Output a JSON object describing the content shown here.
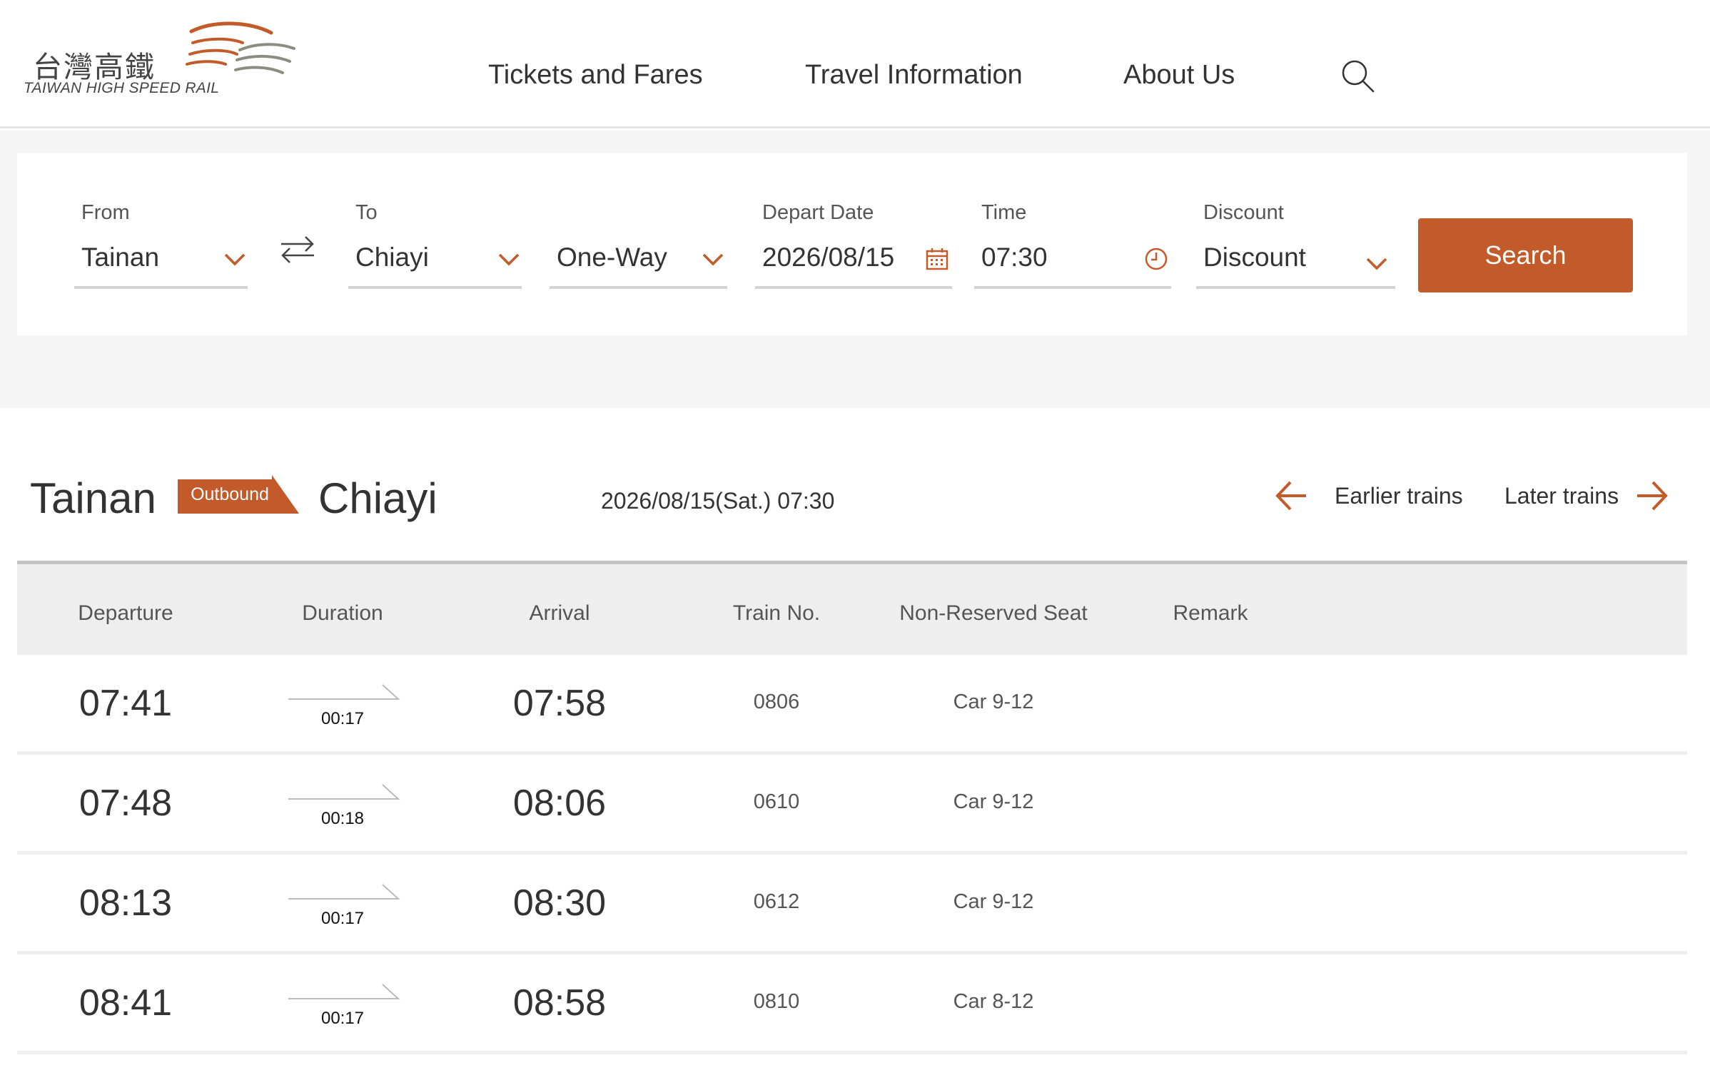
{
  "header": {
    "logo_cn": "台灣高鐵",
    "logo_en": "TAIWAN HIGH SPEED RAIL",
    "nav": [
      {
        "label": "Tickets and Fares"
      },
      {
        "label": "Travel Information"
      },
      {
        "label": "About Us"
      }
    ],
    "search_icon": "search-icon"
  },
  "search_form": {
    "from": {
      "label": "From",
      "value": "Tainan"
    },
    "to": {
      "label": "To",
      "value": "Chiayi"
    },
    "trip_type": {
      "value": "One-Way"
    },
    "depart_date": {
      "label": "Depart Date",
      "value": "2026/08/15"
    },
    "time": {
      "label": "Time",
      "value": "07:30"
    },
    "discount": {
      "label": "Discount",
      "value": "Discount"
    },
    "search_label": "Search",
    "swap_icon": "swap-icon"
  },
  "results": {
    "origin": "Tainan",
    "direction_badge": "Outbound",
    "destination": "Chiayi",
    "datetime": "2026/08/15(Sat.) 07:30",
    "earlier_label": "Earlier trains",
    "later_label": "Later trains",
    "columns": [
      "Departure",
      "Duration",
      "Arrival",
      "Train No.",
      "Non-Reserved Seat",
      "Remark"
    ],
    "rows": [
      {
        "departure": "07:41",
        "duration": "00:17",
        "arrival": "07:58",
        "train_no": "0806",
        "non_reserved": "Car 9-12",
        "remark": ""
      },
      {
        "departure": "07:48",
        "duration": "00:18",
        "arrival": "08:06",
        "train_no": "0610",
        "non_reserved": "Car 9-12",
        "remark": ""
      },
      {
        "departure": "08:13",
        "duration": "00:17",
        "arrival": "08:30",
        "train_no": "0612",
        "non_reserved": "Car 9-12",
        "remark": ""
      },
      {
        "departure": "08:41",
        "duration": "00:17",
        "arrival": "08:58",
        "train_no": "0810",
        "non_reserved": "Car 8-12",
        "remark": ""
      }
    ]
  },
  "colors": {
    "accent": "#c35a2a",
    "text": "#333333",
    "panel_bg": "#f5f5f5",
    "table_header_bg": "#eeeeee"
  }
}
